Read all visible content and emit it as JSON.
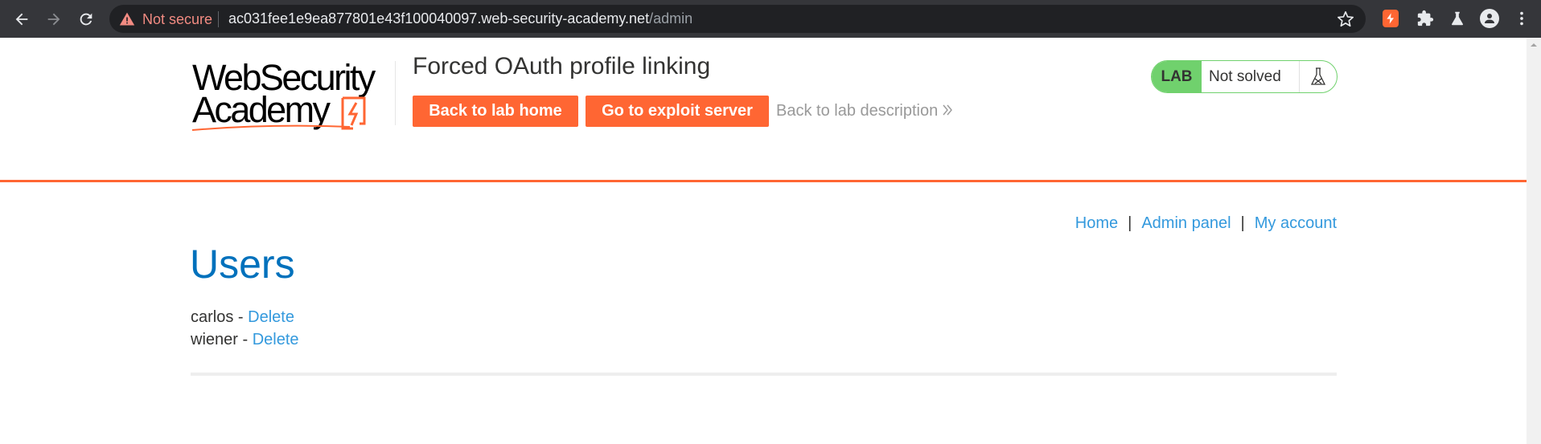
{
  "browser": {
    "security_label": "Not secure",
    "url_host": "ac031fee1e9ea877801e43f100040097.web-security-academy.net",
    "url_path": "/admin"
  },
  "header": {
    "logo_line1": "WebSecurity",
    "logo_line2": "Academy",
    "lab_title": "Forced OAuth profile linking",
    "back_home_label": "Back to lab home",
    "exploit_server_label": "Go to exploit server",
    "back_description_label": "Back to lab description",
    "lab_badge_label": "LAB",
    "lab_status": "Not solved"
  },
  "nav": {
    "home": "Home",
    "separator": "|",
    "admin_panel": "Admin panel",
    "my_account": "My account"
  },
  "main": {
    "heading": "Users",
    "users": [
      {
        "name": "carlos",
        "separator": "-",
        "action": "Delete"
      },
      {
        "name": "wiener",
        "separator": "-",
        "action": "Delete"
      }
    ]
  },
  "colors": {
    "brand_orange": "#ff6633",
    "lab_green": "#70d16d",
    "heading_blue": "#0071bc",
    "link_blue": "#3399dd"
  }
}
